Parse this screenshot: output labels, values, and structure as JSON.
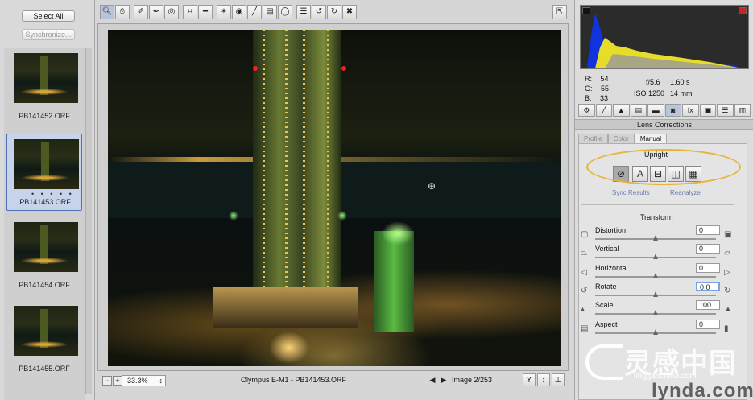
{
  "filmstrip": {
    "select_all": "Select All",
    "synchronize": "Synchronize...",
    "items": [
      {
        "name": "PB141452.ORF"
      },
      {
        "name": "PB141453.ORF",
        "selected": true,
        "dots": "• • • • •"
      },
      {
        "name": "PB141454.ORF"
      },
      {
        "name": "PB141455.ORF"
      }
    ]
  },
  "toolbar": {
    "tools": [
      "zoom-icon",
      "hand-icon",
      "white-balance-icon",
      "color-sampler-icon",
      "target-adjust-icon",
      "crop-icon",
      "straighten-icon",
      "spot-removal-icon",
      "red-eye-icon",
      "adjustment-brush-icon",
      "graduated-filter-icon",
      "radial-filter-icon",
      "preferences-icon",
      "rotate-left-icon",
      "rotate-right-icon",
      "trash-icon"
    ],
    "fullscreen_icon": "fullscreen-icon"
  },
  "status": {
    "zoom": "33.3%",
    "filename": "Olympus E-M1  -  PB141453.ORF",
    "image_counter": "Image 2/253"
  },
  "histogram": {
    "r_label": "R:",
    "r": "54",
    "g_label": "G:",
    "g": "55",
    "b_label": "B:",
    "b": "33",
    "aperture": "f/5.6",
    "shutter": "1.60 s",
    "iso": "ISO 1250",
    "focal": "14 mm"
  },
  "panel": {
    "title": "Lens Corrections",
    "subtabs": [
      "Profile",
      "Color",
      "Manual"
    ],
    "active_subtab": "Manual",
    "upright_title": "Upright",
    "sync_results": "Sync Results",
    "reanalyze": "Reanalyze",
    "transform_title": "Transform",
    "sliders": [
      {
        "label": "Distortion",
        "value": "0",
        "pos": 0.5
      },
      {
        "label": "Vertical",
        "value": "0",
        "pos": 0.5
      },
      {
        "label": "Horizontal",
        "value": "0",
        "pos": 0.5
      },
      {
        "label": "Rotate",
        "value": "0.0",
        "pos": 0.5
      },
      {
        "label": "Scale",
        "value": "100",
        "pos": 0.5
      },
      {
        "label": "Aspect",
        "value": "0",
        "pos": 0.5
      }
    ]
  },
  "watermark": {
    "cn": "灵感中国",
    "url": "lingganchina.com",
    "brand": "lynda.com"
  }
}
